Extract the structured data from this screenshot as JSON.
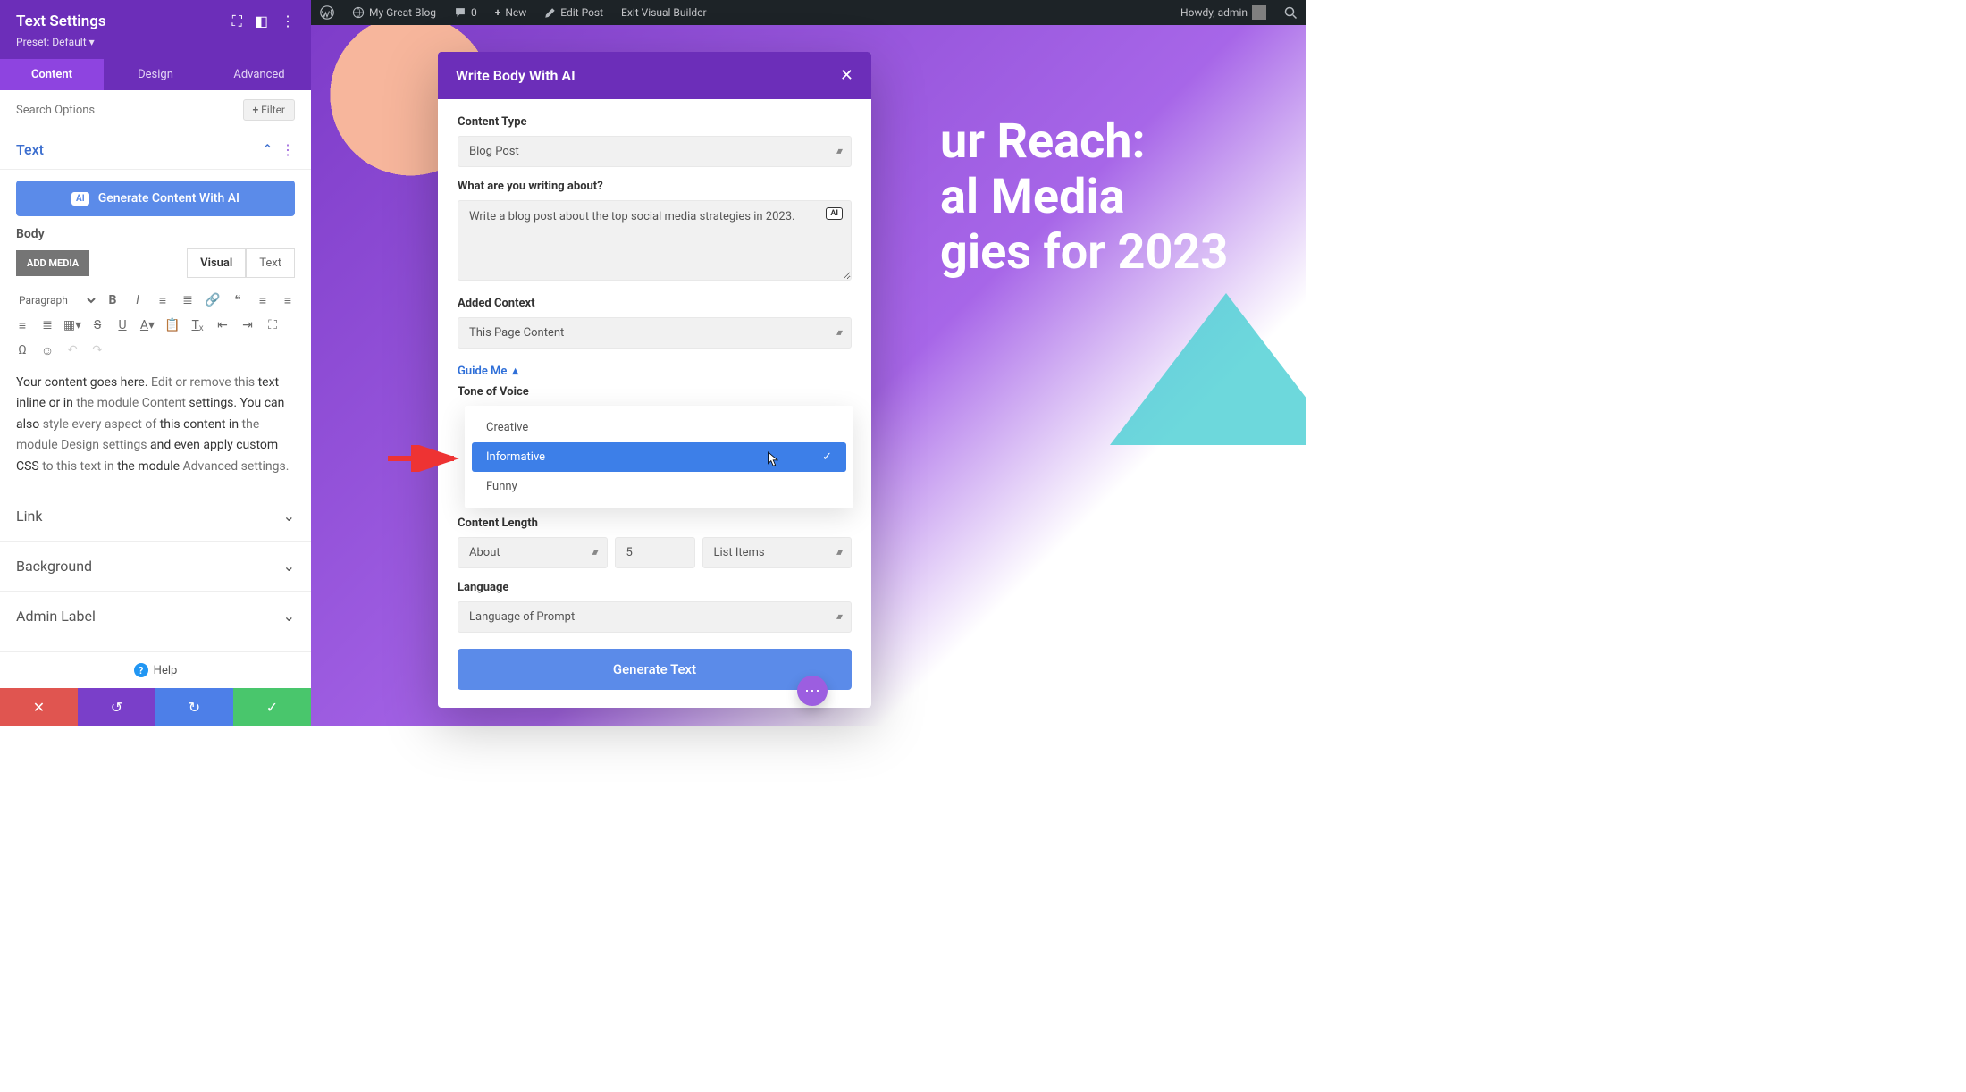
{
  "wp_bar": {
    "site": "My Great Blog",
    "comments": "0",
    "new": "New",
    "edit": "Edit Post",
    "exit": "Exit Visual Builder",
    "howdy": "Howdy, admin"
  },
  "sidebar": {
    "title": "Text Settings",
    "preset": "Preset: Default",
    "tabs": {
      "content": "Content",
      "design": "Design",
      "advanced": "Advanced"
    },
    "search_placeholder": "Search Options",
    "filter": "Filter",
    "section_text": "Text",
    "gen_with_ai": "Generate Content With AI",
    "body_label": "Body",
    "add_media": "ADD MEDIA",
    "editor_visual": "Visual",
    "editor_text": "Text",
    "paragraph_sel": "Paragraph",
    "body_content_dark_a": "Your content goes here.",
    "body_content_light_a": " Edit or remove this ",
    "body_content_dark_b": "text inline or in ",
    "body_content_light_b": "the module Content ",
    "body_content_dark_c": "settings. You can also ",
    "body_content_light_c": "style every aspect of ",
    "body_content_dark_d": "this content in ",
    "body_content_light_d": "the module Design settings ",
    "body_content_dark_e": "and even apply custom CSS ",
    "body_content_light_e": "to this text in ",
    "body_content_dark_f": "the module ",
    "body_content_light_f": "Advanced settings.",
    "link": "Link",
    "background": "Background",
    "admin_label": "Admin Label",
    "help": "Help"
  },
  "hero": {
    "line1": "ur Reach:",
    "line2": "al Media",
    "line3": "gies for 2023"
  },
  "modal": {
    "title": "Write Body With AI",
    "content_type_label": "Content Type",
    "content_type_value": "Blog Post",
    "prompt_label": "What are you writing about?",
    "prompt_value": "Write a blog post about the top social media strategies in 2023.",
    "context_label": "Added Context",
    "context_value": "This Page Content",
    "guide_me": "Guide Me",
    "tone_label": "Tone of Voice",
    "tone_opts": {
      "a": "Creative",
      "b": "Informative",
      "c": "Funny"
    },
    "length_label": "Content Length",
    "length_about": "About",
    "length_count": "5",
    "length_unit": "List Items",
    "language_label": "Language",
    "language_value": "Language of Prompt",
    "generate": "Generate Text"
  }
}
